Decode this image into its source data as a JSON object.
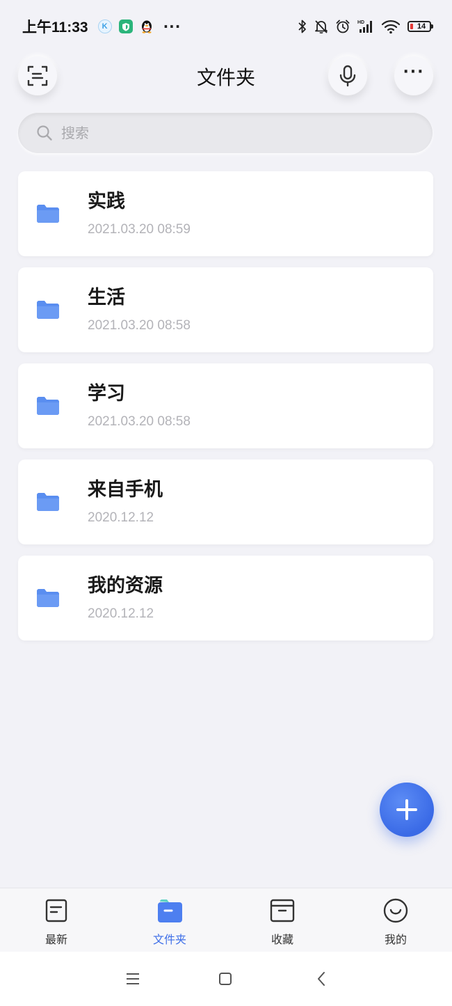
{
  "status_bar": {
    "time": "上午11:33",
    "k_badge": "K",
    "more": "···",
    "battery": "14"
  },
  "header": {
    "title": "文件夹",
    "more": "···"
  },
  "search": {
    "placeholder": "搜索"
  },
  "folders": [
    {
      "name": "实践",
      "date": "2021.03.20 08:59"
    },
    {
      "name": "生活",
      "date": "2021.03.20 08:58"
    },
    {
      "name": "学习",
      "date": "2021.03.20 08:58"
    },
    {
      "name": "来自手机",
      "date": "2020.12.12"
    },
    {
      "name": "我的资源",
      "date": "2020.12.12"
    }
  ],
  "bottom_nav": {
    "items": [
      {
        "label": "最新",
        "icon": "document-icon"
      },
      {
        "label": "文件夹",
        "icon": "folder-icon",
        "active": true
      },
      {
        "label": "收藏",
        "icon": "archive-box-icon"
      },
      {
        "label": "我的",
        "icon": "smile-icon"
      }
    ]
  },
  "colors": {
    "accent": "#3d6ee8",
    "folder": "#5a8ef0",
    "background": "#f2f2f7",
    "battery_low": "#e53935"
  }
}
